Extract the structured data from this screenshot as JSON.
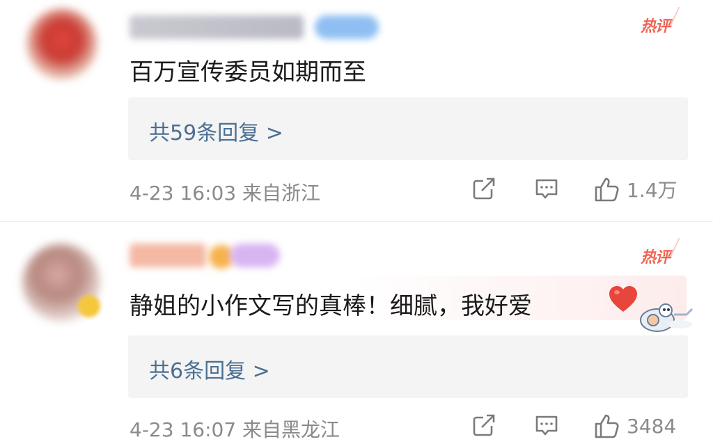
{
  "comments": [
    {
      "hot_label": "热评",
      "text": "百万宣传委员如期而至",
      "reply_summary": "共59条回复 >",
      "meta": "4-23 16:03 来自浙江",
      "likes": "1.4万"
    },
    {
      "hot_label": "热评",
      "text": "静姐的小作文写的真棒！细腻，我好爱",
      "reply_summary": "共6条回复 >",
      "meta": "4-23 16:07 来自黑龙江",
      "likes": "3484"
    }
  ],
  "icons": {
    "share": "share-icon",
    "comment": "comment-icon",
    "like": "thumbs-up-icon",
    "heart": "heart-emoji-icon",
    "mascot": "mascot-sticker-icon"
  },
  "colors": {
    "hot": "#f06452",
    "reply_link": "#4b6f93",
    "meta": "#8a8a8a",
    "heart": "#e8453c"
  }
}
